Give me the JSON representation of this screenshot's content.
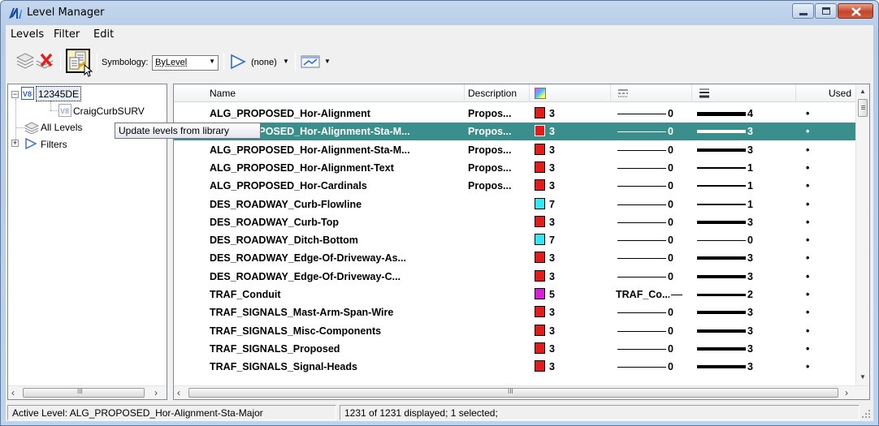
{
  "window": {
    "title": "Level Manager"
  },
  "menu": [
    "Levels",
    "Filter",
    "Edit"
  ],
  "toolbar": {
    "symbology_label": "Symbology:",
    "symbology_value": "ByLevel",
    "filter_value": "(none)",
    "tooltip": "Update levels from library"
  },
  "tree": {
    "root_label": "12345DE",
    "child_label": "CraigCurbSURV",
    "all_levels": "All Levels",
    "filters": "Filters"
  },
  "columns": {
    "name": "Name",
    "description": "Description",
    "used": "Used"
  },
  "rows": [
    {
      "name": "ALG_PROPOSED_Hor-Alignment",
      "desc": "Propos...",
      "color_hex": "#e41b1b",
      "color": "3",
      "style": "",
      "style_num": "0",
      "weight": "4",
      "used": "•",
      "selected": false
    },
    {
      "name": "ALG_PROPOSED_Hor-Alignment-Sta-M...",
      "desc": "Propos...",
      "color_hex": "#e41b1b",
      "color": "3",
      "style": "",
      "style_num": "0",
      "weight": "3",
      "used": "•",
      "selected": true
    },
    {
      "name": "ALG_PROPOSED_Hor-Alignment-Sta-M...",
      "desc": "Propos...",
      "color_hex": "#e41b1b",
      "color": "3",
      "style": "",
      "style_num": "0",
      "weight": "3",
      "used": "•",
      "selected": false
    },
    {
      "name": "ALG_PROPOSED_Hor-Alignment-Text",
      "desc": "Propos...",
      "color_hex": "#e41b1b",
      "color": "3",
      "style": "",
      "style_num": "0",
      "weight": "1",
      "used": "•",
      "selected": false
    },
    {
      "name": "ALG_PROPOSED_Hor-Cardinals",
      "desc": "Propos...",
      "color_hex": "#e41b1b",
      "color": "3",
      "style": "",
      "style_num": "0",
      "weight": "1",
      "used": "•",
      "selected": false
    },
    {
      "name": "DES_ROADWAY_Curb-Flowline",
      "desc": "",
      "color_hex": "#2fe8f0",
      "color": "7",
      "style": "",
      "style_num": "0",
      "weight": "1",
      "used": "•",
      "selected": false
    },
    {
      "name": "DES_ROADWAY_Curb-Top",
      "desc": "",
      "color_hex": "#e41b1b",
      "color": "3",
      "style": "",
      "style_num": "0",
      "weight": "3",
      "used": "•",
      "selected": false
    },
    {
      "name": "DES_ROADWAY_Ditch-Bottom",
      "desc": "",
      "color_hex": "#2fe8f0",
      "color": "7",
      "style": "",
      "style_num": "0",
      "weight": "0",
      "used": "•",
      "selected": false
    },
    {
      "name": "DES_ROADWAY_Edge-Of-Driveway-As...",
      "desc": "",
      "color_hex": "#e41b1b",
      "color": "3",
      "style": "",
      "style_num": "0",
      "weight": "3",
      "used": "•",
      "selected": false
    },
    {
      "name": "DES_ROADWAY_Edge-Of-Driveway-C...",
      "desc": "",
      "color_hex": "#e41b1b",
      "color": "3",
      "style": "",
      "style_num": "0",
      "weight": "3",
      "used": "•",
      "selected": false
    },
    {
      "name": "TRAF_Conduit",
      "desc": "",
      "color_hex": "#d61fd6",
      "color": "5",
      "style": "TRAF_Co...",
      "style_num": "",
      "weight": "2",
      "used": "•",
      "selected": false
    },
    {
      "name": "TRAF_SIGNALS_Mast-Arm-Span-Wire",
      "desc": "",
      "color_hex": "#e41b1b",
      "color": "3",
      "style": "",
      "style_num": "0",
      "weight": "3",
      "used": "•",
      "selected": false
    },
    {
      "name": "TRAF_SIGNALS_Misc-Components",
      "desc": "",
      "color_hex": "#e41b1b",
      "color": "3",
      "style": "",
      "style_num": "0",
      "weight": "3",
      "used": "•",
      "selected": false
    },
    {
      "name": "TRAF_SIGNALS_Proposed",
      "desc": "",
      "color_hex": "#e41b1b",
      "color": "3",
      "style": "",
      "style_num": "0",
      "weight": "3",
      "used": "•",
      "selected": false
    },
    {
      "name": "TRAF_SIGNALS_Signal-Heads",
      "desc": "",
      "color_hex": "#e41b1b",
      "color": "3",
      "style": "",
      "style_num": "0",
      "weight": "3",
      "used": "•",
      "selected": false
    }
  ],
  "status": {
    "active_level": "Active Level: ALG_PROPOSED_Hor-Alignment-Sta-Major",
    "count": "1231 of 1231 displayed; 1 selected;"
  },
  "scroll": {
    "left_glyph": "‹",
    "right_glyph": "›",
    "thumb_glyph": "III",
    "up_glyph": "▲",
    "down_glyph": "▼"
  }
}
